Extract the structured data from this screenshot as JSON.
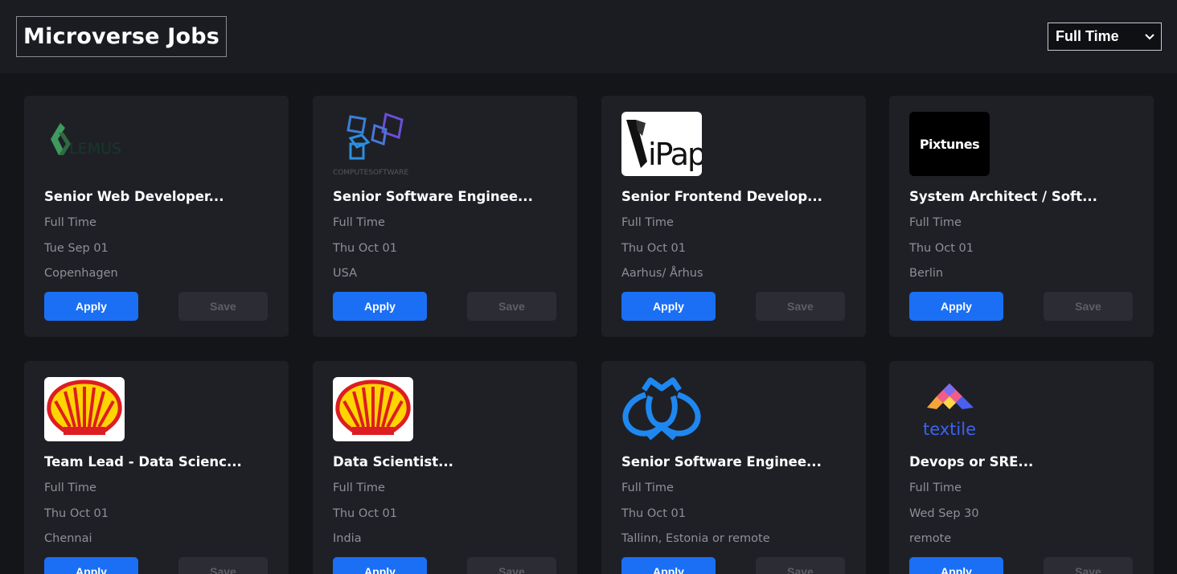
{
  "header": {
    "brand": "Microverse Jobs"
  },
  "filter": {
    "selected": "Full Time"
  },
  "buttons": {
    "apply": "Apply",
    "save": "Save"
  },
  "logos": {
    "lemus": {
      "icon": "lemus-logo-icon",
      "text": "LEMUS"
    },
    "computesoftware": {
      "icon": "computesoftware-logo-icon",
      "text": "COMPUTESOFTWARE"
    },
    "ipaper": {
      "icon": "ipaper-logo-icon",
      "text": "iPaper"
    },
    "pixtunes": {
      "icon": "pixtunes-logo-icon",
      "text": "Pixtunes"
    },
    "shell": {
      "icon": "shell-logo-icon"
    },
    "crown": {
      "icon": "crown-shield-logo-icon"
    },
    "textile": {
      "icon": "textile-logo-icon",
      "text": "textile"
    }
  },
  "jobs": [
    {
      "title": "Senior Web Developer...",
      "type": "Full Time",
      "date": "Tue Sep 01",
      "location": "Copenhagen"
    },
    {
      "title": "Senior Software Enginee...",
      "type": "Full Time",
      "date": "Thu Oct 01",
      "location": "USA"
    },
    {
      "title": "Senior Frontend Develop...",
      "type": "Full Time",
      "date": "Thu Oct 01",
      "location": "Aarhus/ Århus"
    },
    {
      "title": "System Architect / Soft...",
      "type": "Full Time",
      "date": "Thu Oct 01",
      "location": "Berlin"
    },
    {
      "title": "Team Lead - Data Scienc...",
      "type": "Full Time",
      "date": "Thu Oct 01",
      "location": "Chennai"
    },
    {
      "title": "Data Scientist...",
      "type": "Full Time",
      "date": "Thu Oct 01",
      "location": "India"
    },
    {
      "title": "Senior Software Enginee...",
      "type": "Full Time",
      "date": "Thu Oct 01",
      "location": "Tallinn, Estonia or remote"
    },
    {
      "title": "Devops or SRE...",
      "type": "Full Time",
      "date": "Wed Sep 30",
      "location": "remote"
    }
  ],
  "colors": {
    "background": "#141519",
    "header": "#1b1c21",
    "card": "#1f2026",
    "apply": "#1a6ff5",
    "save": "#2c2d34",
    "muted_text": "#8e9097"
  }
}
